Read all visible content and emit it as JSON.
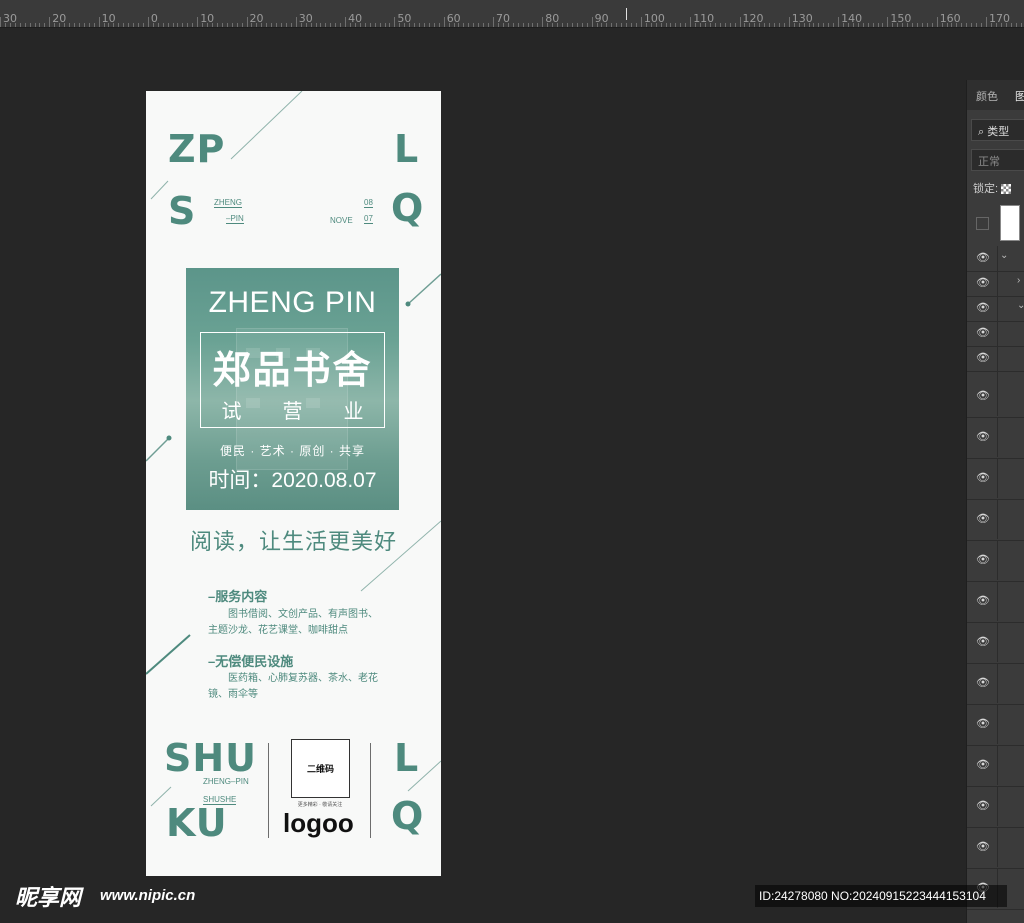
{
  "ruler": {
    "labels": [
      "30",
      "20",
      "10",
      "0",
      "10",
      "20",
      "30",
      "40",
      "50",
      "60",
      "70",
      "80",
      "90",
      "100",
      "110",
      "120",
      "130",
      "140",
      "150",
      "160",
      "170"
    ]
  },
  "poster": {
    "corner_tl_1": "ZP",
    "corner_tl_2": "S",
    "corner_tr_1": "L",
    "corner_tr_2": "Q",
    "small_zheng": "ZHENG",
    "small_pin": "–PIN",
    "small_08": "08",
    "small_07": "07",
    "small_nove": "NOVE",
    "hero_title": "ZHENG PIN",
    "hero_callig": "郑品书舍",
    "hero_trial": [
      "试",
      "营",
      "业"
    ],
    "hero_slogan": "便民 · 艺术 · 原创 · 共享",
    "hero_date": "时间：2020.08.07",
    "tagline": "阅读，让生活更美好",
    "section1_title": "–服务内容",
    "section1_body": "　　图书借阅、文创产品、有声图书、主题沙龙、花艺课堂、咖啡甜点",
    "section2_title": "–无偿便民设施",
    "section2_body": "　　医药箱、心肺复苏器、茶水、老花镜、雨伞等",
    "bottom_shu": "SHU",
    "bottom_ku": "KU",
    "bottom_zhengpin": "ZHENG–PIN",
    "bottom_shushe": "SHUSHE",
    "qr_label": "二维码",
    "qr_caption": "更多精彩 · 敬请关注",
    "logo": "logoo",
    "bottom_l": "L",
    "bottom_q": "Q"
  },
  "panel": {
    "tab_color": "颜色",
    "tab_layers": "图",
    "filter": "类型",
    "blend": "正常",
    "lock": "锁定:"
  },
  "watermark": {
    "site_cn": "昵享网",
    "site_url": "www.nipic.cn",
    "id_text": "ID:24278080 NO:20240915223444153104"
  },
  "colors": {
    "accent": "#4e8a7e",
    "bg": "#262626"
  }
}
